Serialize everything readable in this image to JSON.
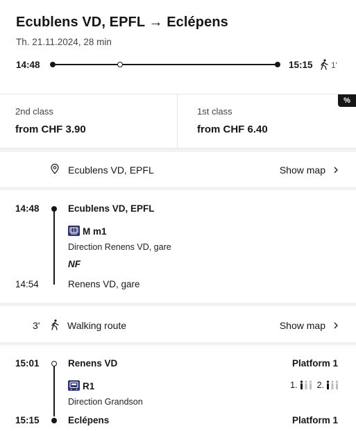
{
  "header": {
    "title": "Ecublens VD, EPFL → Eclépens",
    "subtitle": "Th. 21.11.2024, 28 min",
    "departure_time": "14:48",
    "arrival_time": "15:15",
    "walk_minutes": "1'"
  },
  "prices": {
    "badge": "%",
    "second_class": {
      "label": "2nd class",
      "value": "from CHF 3.90"
    },
    "first_class": {
      "label": "1st class",
      "value": "from CHF 6.40"
    }
  },
  "origin_row": {
    "place": "Ecublens VD, EPFL",
    "action": "Show map"
  },
  "leg1": {
    "dep_time": "14:48",
    "dep_stop": "Ecublens VD, EPFL",
    "line": "M m1",
    "direction": "Direction Renens VD, gare",
    "note": "NF",
    "arr_time": "14:54",
    "arr_stop": "Renens VD, gare"
  },
  "walk_row": {
    "minutes": "3'",
    "label": "Walking route",
    "action": "Show map"
  },
  "leg2": {
    "dep_time": "15:01",
    "dep_stop": "Renens VD",
    "dep_platform": "Platform 1",
    "line": "R1",
    "direction": "Direction Grandson",
    "occupancy_first": "1.",
    "occupancy_second": "2.",
    "arr_time": "15:15",
    "arr_stop": "Eclépens",
    "arr_platform": "Platform 1"
  },
  "colors": {
    "accent": "#161616",
    "line_badge": "#2d327d",
    "separator": "#f2f2f2"
  },
  "icons": [
    "walking-icon",
    "location-pin-icon",
    "chevron-right-icon",
    "metro-icon",
    "train-icon",
    "person-icon"
  ]
}
